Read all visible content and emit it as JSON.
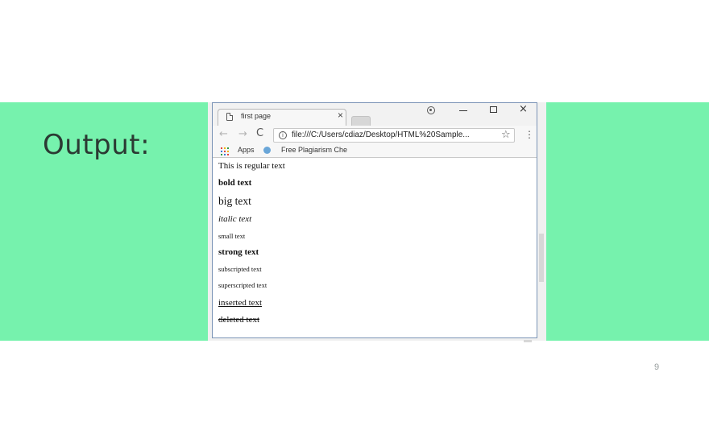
{
  "slide": {
    "heading": "Output:",
    "page_number": "9",
    "background_color": "#76f2ad"
  },
  "browser": {
    "tab_title": "first page",
    "tab_close": "×",
    "url": "file:///C:/Users/cdiaz/Desktop/HTML%20Sample...",
    "window_controls": {
      "minimize": "minimize-icon",
      "maximize": "maximize-icon",
      "close": "×"
    },
    "nav": {
      "back": "←",
      "forward": "→",
      "reload": "C"
    },
    "star": "☆",
    "menu": "⋮",
    "bookmarks": {
      "apps_label": "Apps",
      "item_label": "Free Plagiarism Che"
    },
    "info_glyph": "i"
  },
  "page_content": {
    "regular": "This is regular text",
    "bold": "bold text",
    "big": "big text",
    "italic": "italic text",
    "small": "small text",
    "strong": "strong text",
    "subscripted": "subscripted text",
    "superscripted": "superscripted text",
    "inserted": "inserted text",
    "deleted": "deleted text"
  }
}
